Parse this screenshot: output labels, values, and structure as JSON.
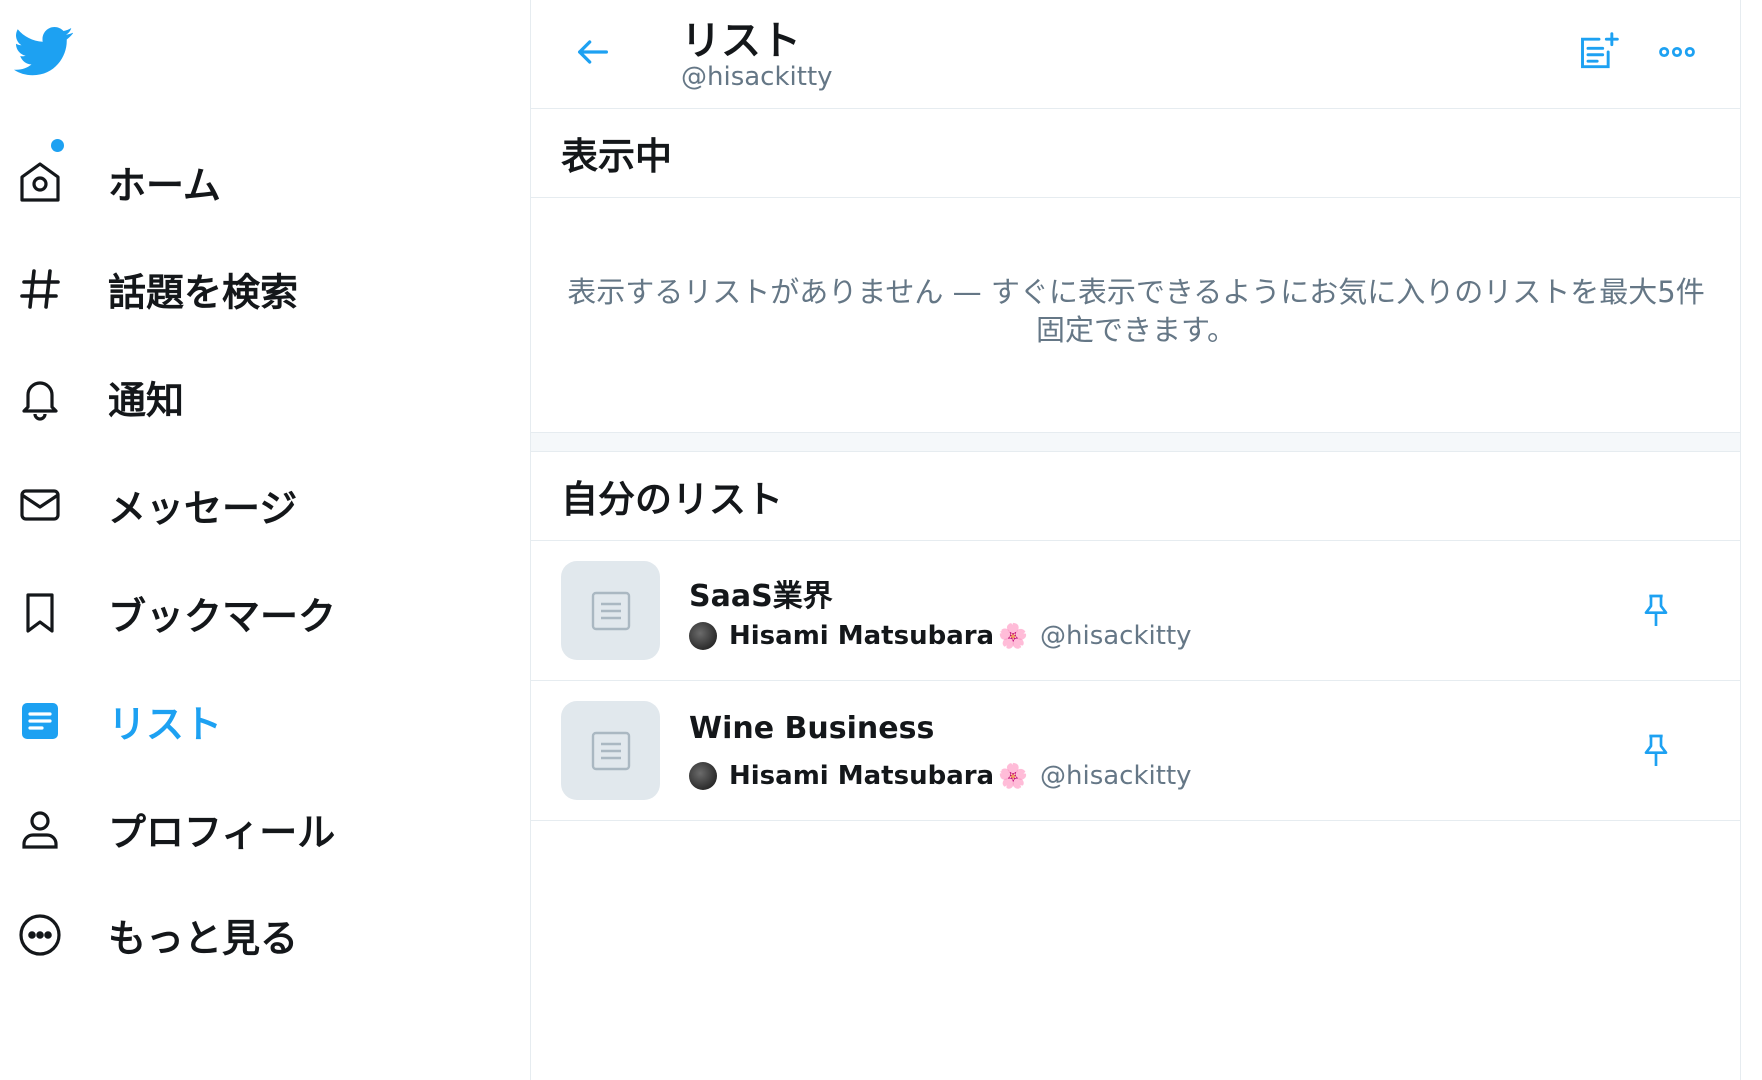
{
  "sidebar": {
    "logo_icon": "twitter-bird-icon",
    "items": [
      {
        "label": "ホーム",
        "icon": "home-icon"
      },
      {
        "label": "話題を検索",
        "icon": "hashtag-icon"
      },
      {
        "label": "通知",
        "icon": "bell-icon"
      },
      {
        "label": "メッセージ",
        "icon": "envelope-icon"
      },
      {
        "label": "ブックマーク",
        "icon": "bookmark-icon"
      },
      {
        "label": "リスト",
        "icon": "list-icon",
        "active": true
      },
      {
        "label": "プロフィール",
        "icon": "person-icon"
      },
      {
        "label": "もっと見る",
        "icon": "more-circle-icon"
      }
    ]
  },
  "header": {
    "title": "リスト",
    "subtitle": "@hisackitty"
  },
  "pinned": {
    "title": "表示中",
    "empty_text": "表示するリストがありません — すぐに表示できるようにお気に入りのリストを最大5件固定できます。"
  },
  "my_lists": {
    "title": "自分のリスト",
    "items": [
      {
        "name": "SaaS業界",
        "owner_name": "Hisami Matsubara",
        "owner_emoji": "🌸",
        "owner_handle": "@hisackitty"
      },
      {
        "name": "Wine Business",
        "owner_name": "Hisami Matsubara",
        "owner_emoji": "🌸",
        "owner_handle": "@hisackitty"
      }
    ]
  },
  "colors": {
    "accent": "#1da1f2",
    "text": "#14171a",
    "secondary": "#657786",
    "border": "#e6ecf0"
  }
}
